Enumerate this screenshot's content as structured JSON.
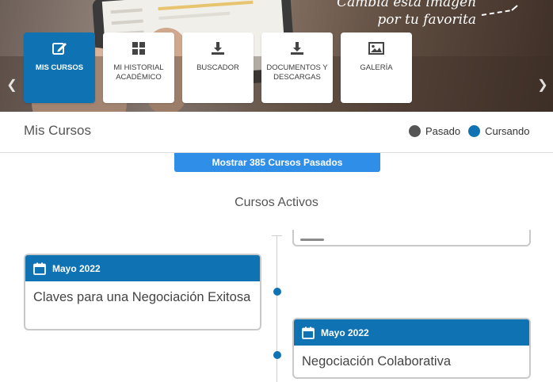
{
  "banner": {
    "promo_line1": "Cambia esta imagen",
    "promo_line2": "por tu favorita",
    "tiles": [
      {
        "label": "MIS CURSOS",
        "icon": "edit-icon",
        "active": true
      },
      {
        "label": "MI HISTORIAL ACADÉMICO",
        "icon": "grid-icon",
        "active": false
      },
      {
        "label": "BUSCADOR",
        "icon": "download-icon",
        "active": false
      },
      {
        "label": "DOCUMENTOS Y DESCARGAS",
        "icon": "download-icon",
        "active": false
      },
      {
        "label": "GALERÍA",
        "icon": "image-icon",
        "active": false
      }
    ]
  },
  "header": {
    "title": "Mis Cursos",
    "legend": [
      {
        "label": "Pasado",
        "color": "#555555"
      },
      {
        "label": "Cursando",
        "color": "#0f73b3"
      }
    ]
  },
  "show_past_button": "Mostrar 385 Cursos Pasados",
  "section_title": "Cursos Activos",
  "timeline": [
    {
      "date": "Mayo 2022",
      "title": "Claves para una Negociación Exitosa",
      "side": "left"
    },
    {
      "date": "Mayo 2022",
      "title": "Negociación Colaborativa",
      "side": "right"
    }
  ],
  "colors": {
    "accent": "#0f73b3",
    "button": "#2f8fe8"
  }
}
